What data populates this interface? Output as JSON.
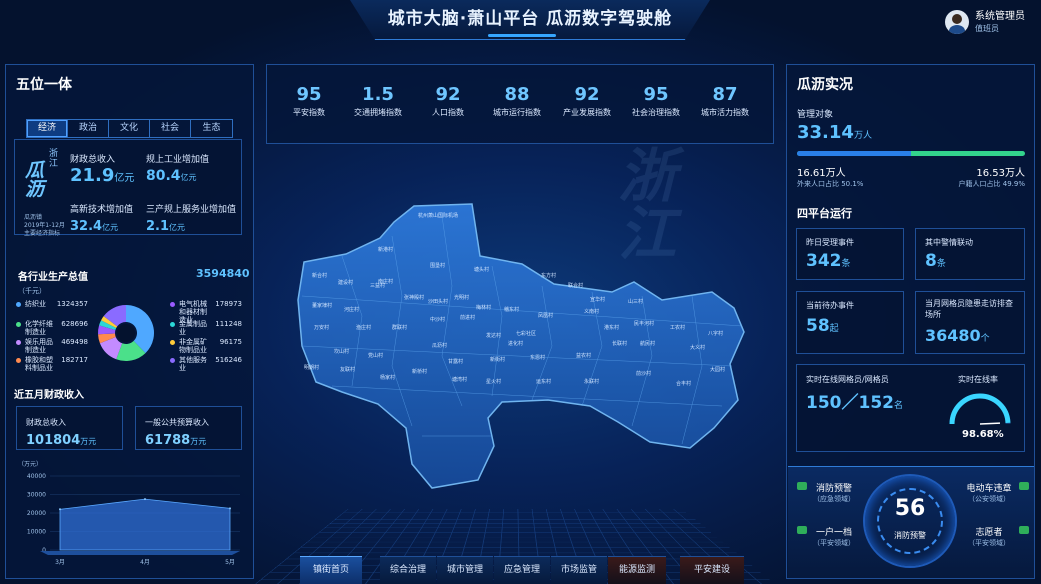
{
  "header": {
    "title": "城市大脑·萧山平台 瓜沥数字驾驶舱",
    "user_name": "系统管理员",
    "user_role": "值班员"
  },
  "left": {
    "title": "五位一体",
    "tabs": [
      "经济",
      "政治",
      "文化",
      "社会",
      "生态"
    ],
    "logo": {
      "brand_top": "浙江",
      "brand_main": "瓜沥",
      "caption_1": "瓜沥镇",
      "caption_2": "2019年1-12月",
      "caption_3": "主要经济指标"
    },
    "metrics": [
      {
        "label": "财政总收入",
        "value": "21.9",
        "unit": "亿元"
      },
      {
        "label": "规上工业增加值",
        "value": "80.4",
        "unit": "亿元"
      },
      {
        "label": "高新技术增加值",
        "value": "32.4",
        "unit": "亿元"
      },
      {
        "label": "三产规上服务业增加值",
        "value": "2.1",
        "unit": "亿元"
      }
    ],
    "industry": {
      "title": "各行业生产总值",
      "total": "3594840",
      "unit": "（千元）",
      "items": [
        {
          "name": "纺织业",
          "value": "1324357",
          "color": "#4fa8ff"
        },
        {
          "name": "化学纤维制造业",
          "value": "628696",
          "color": "#4be08a"
        },
        {
          "name": "娱乐用品制造业",
          "value": "469498",
          "color": "#c38bff"
        },
        {
          "name": "橡胶和塑料制品业",
          "value": "182717",
          "color": "#ff8a4f"
        },
        {
          "name": "电气机械和器材制造业",
          "value": "178973",
          "color": "#9a5bff"
        },
        {
          "name": "金属制品业",
          "value": "111248",
          "color": "#2bd7d7"
        },
        {
          "name": "非金属矿物制品业",
          "value": "96175",
          "color": "#ffcc3a"
        },
        {
          "name": "其他服务业",
          "value": "516246",
          "color": "#8a6bff"
        }
      ]
    },
    "finance": {
      "title": "近五月财政收入",
      "box1_label": "财政总收入",
      "box1_value": "101804",
      "box1_unit": "万元",
      "box2_label": "一般公共预算收入",
      "box2_value": "61788",
      "box2_unit": "万元"
    },
    "chart_data": {
      "type": "area",
      "ylabel": "（万元）",
      "yticks": [
        "40000",
        "30000",
        "20000",
        "10000",
        "0"
      ],
      "categories": [
        "3月",
        "4月",
        "5月"
      ],
      "values": [
        22000,
        27500,
        22500
      ],
      "ylim": [
        0,
        40000
      ],
      "color": "#2f6fd6"
    }
  },
  "indices": [
    {
      "value": "95",
      "label": "平安指数"
    },
    {
      "value": "1.5",
      "label": "交通拥堵指数"
    },
    {
      "value": "92",
      "label": "人口指数"
    },
    {
      "value": "88",
      "label": "城市运行指数"
    },
    {
      "value": "92",
      "label": "产业发展指数"
    },
    {
      "value": "95",
      "label": "社会治理指数"
    },
    {
      "value": "87",
      "label": "城市活力指数"
    }
  ],
  "map": {
    "labels": [
      "杭州萧山国际机场",
      "新港村",
      "围垦村",
      "南庄村",
      "塘头村",
      "新合村",
      "建设村",
      "东方村",
      "联合村",
      "三益村",
      "张神殿村",
      "沙田头村",
      "光明村",
      "梅林村",
      "凤凰村",
      "董家埭村",
      "河庄村",
      "万安村",
      "渔庄村",
      "群联村",
      "中沙村",
      "前进村",
      "稽东村",
      "义南村",
      "发达村",
      "七彩社区",
      "进化村",
      "宣华村",
      "山三村",
      "港东村",
      "民丰河村",
      "工农村",
      "八字村",
      "坎山村",
      "党山村",
      "瓜沥村",
      "甘露村",
      "新街村",
      "东恩村",
      "益农村",
      "长联村",
      "航民村",
      "大义村",
      "明朗村",
      "友联村",
      "杨家村",
      "新桥村",
      "塘湾村",
      "星火村",
      "运东村",
      "永联村",
      "前沙村",
      "合丰村",
      "大园村"
    ]
  },
  "right": {
    "title": "瓜沥实况",
    "manage_label": "管理对象",
    "manage_value": "33.14",
    "manage_unit": "万人",
    "outside_value": "16.61万人",
    "outside_label": "外来人口占比 50.1%",
    "local_value": "16.53万人",
    "local_label": "户籍人口占比 49.9%",
    "outside_ratio": 0.501,
    "sub_title": "四平台运行",
    "cards": [
      {
        "label": "昨日受理事件",
        "value": "342",
        "unit": "条"
      },
      {
        "label": "其中警情联动",
        "value": "8",
        "unit": "条"
      },
      {
        "label": "当前待办事件",
        "value": "58",
        "unit": "起"
      },
      {
        "label": "当月网格员隐患走访排查场所",
        "value": "36480",
        "unit": "个"
      }
    ],
    "online_label": "实时在线网格员/网格员",
    "online_value": "150／152",
    "online_unit": "名",
    "rate_label": "实时在线率",
    "rate_value": "98.68%",
    "rate_fraction": 0.9868,
    "alerts": {
      "fire_label": "消防预警",
      "fire_sub": "（应急领域）",
      "ebike_label": "电动车违章",
      "ebike_sub": "（公安领域）",
      "household_label": "一户一档",
      "household_sub": "（平安领域）",
      "volunteer_label": "志愿者",
      "volunteer_sub": "（平安领域）",
      "center_value": "56",
      "center_label": "消防预警"
    }
  },
  "nav": [
    "镇街首页",
    "综合治理",
    "城市管理",
    "应急管理",
    "市场监管",
    "能源监测",
    "平安建设"
  ]
}
